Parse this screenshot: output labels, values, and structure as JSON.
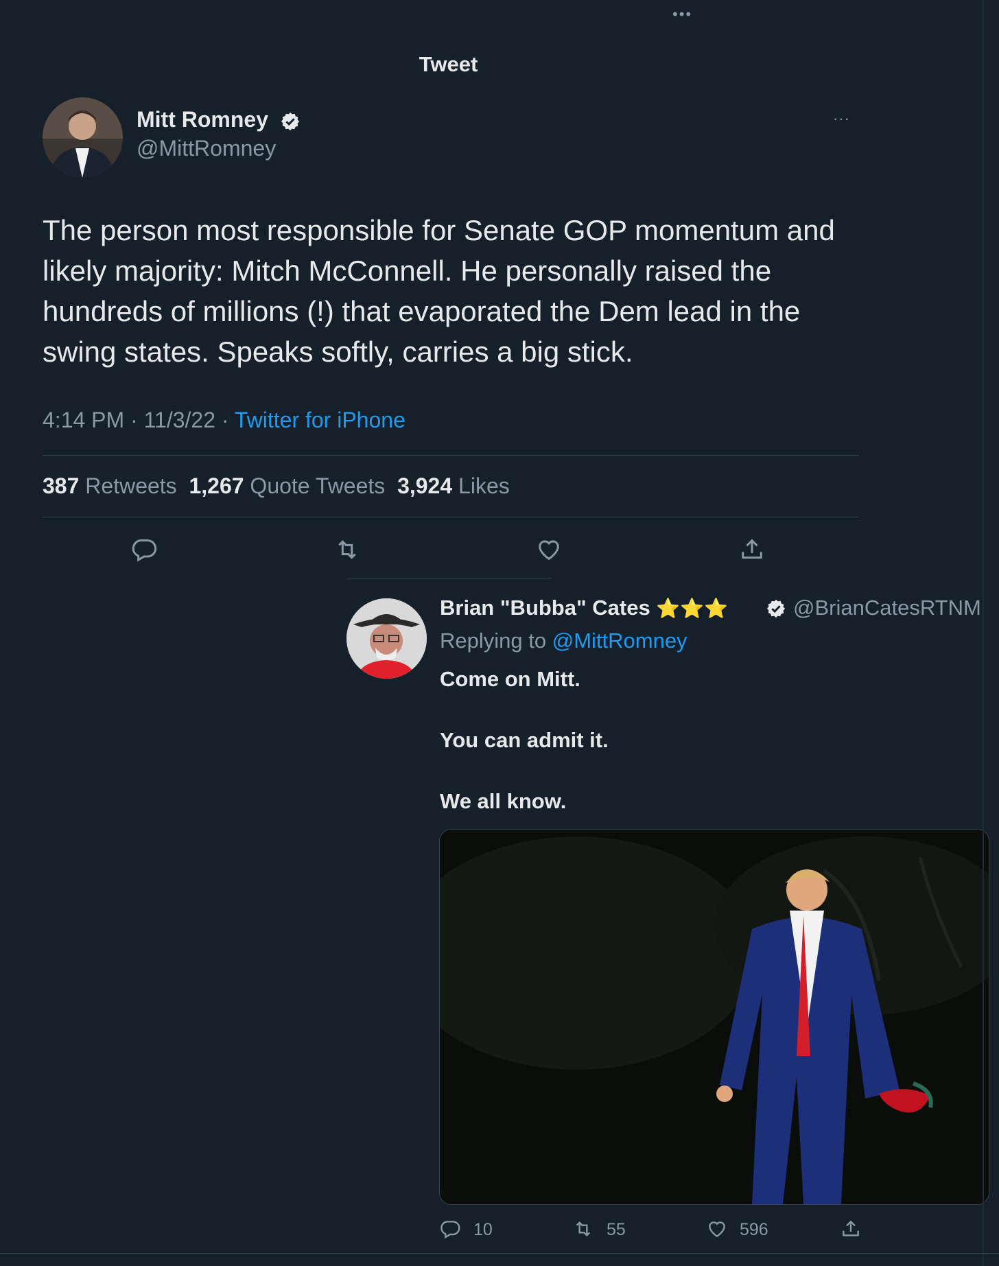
{
  "header": {
    "title": "Tweet",
    "more_dots": "•••"
  },
  "tweet": {
    "author": {
      "name": "Mitt Romney",
      "handle": "@MittRomney"
    },
    "body": "The person most responsible for Senate GOP momentum and likely majority: Mitch McConnell. He personally raised the hundreds of millions (!) that evaporated the Dem lead in the swing states. Speaks softly, carries a big stick.",
    "time": "4:14 PM",
    "date": "11/3/22",
    "separator": "·",
    "source": "Twitter for iPhone",
    "stats": {
      "retweets_count": "387",
      "retweets_label": "Retweets",
      "quotes_count": "1,267",
      "quotes_label": "Quote Tweets",
      "likes_count": "3,924",
      "likes_label": "Likes"
    },
    "actions": [
      "reply-icon",
      "retweet-icon",
      "like-icon",
      "share-icon"
    ]
  },
  "reply": {
    "author": {
      "name": "Brian \"Bubba\" Cates",
      "stars": "⭐⭐⭐",
      "handle": "@BrianCatesRTNM"
    },
    "replying_to_label": "Replying to",
    "replying_to_handle": "@MittRomney",
    "lines": [
      "Come on Mitt.",
      "You can admit it.",
      "We all know."
    ],
    "actions": {
      "replies": "10",
      "retweets": "55",
      "likes": "596"
    }
  },
  "colors": {
    "background": "#15202b",
    "text": "#e7e9ea",
    "muted": "#8b98a5",
    "accent": "#1d9bf0",
    "divider": "#38444d"
  }
}
